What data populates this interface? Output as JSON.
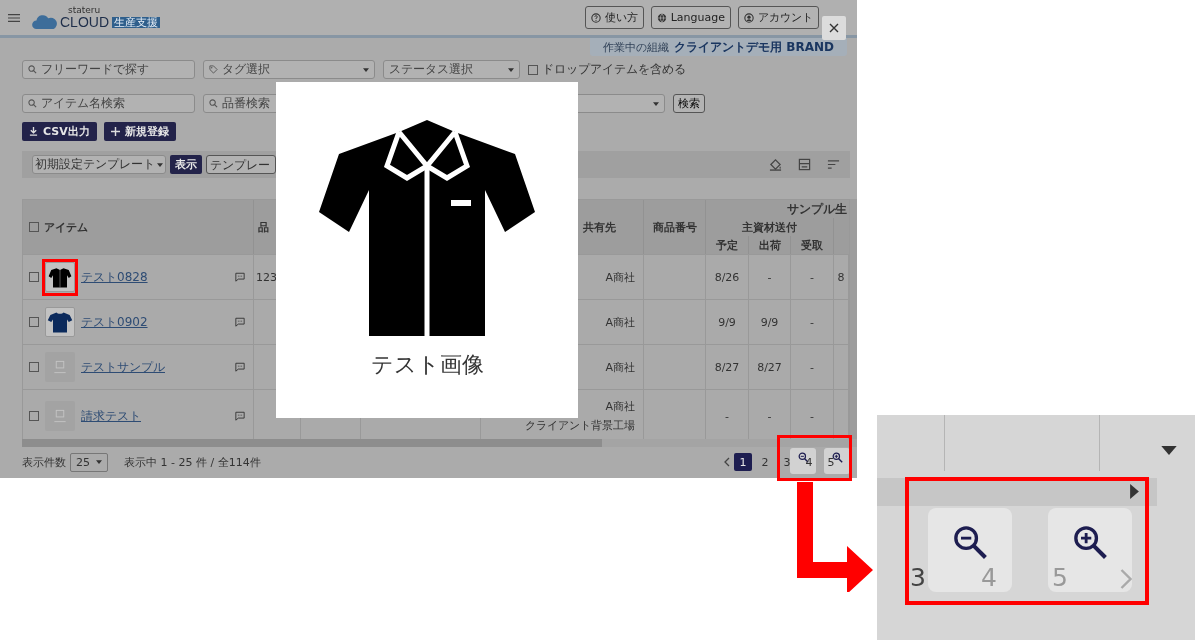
{
  "header": {
    "logo_small": "stateru",
    "logo": "CLOUD",
    "logo_badge": "生産支援",
    "buttons": [
      {
        "label": "使い方"
      },
      {
        "label": "Language"
      },
      {
        "label": "アカウント"
      }
    ]
  },
  "org_banner": {
    "label": "作業中の組織",
    "value": "クライアントデモ用 BRAND"
  },
  "filters": {
    "row1": [
      {
        "kind": "search",
        "placeholder": "フリーワードで探す"
      },
      {
        "kind": "tag",
        "placeholder": "タグ選択"
      },
      {
        "kind": "select",
        "placeholder": "ステータス選択"
      }
    ],
    "drop_checkbox": {
      "label": "ドロップアイテムを含める",
      "checked": false
    },
    "row2": [
      {
        "kind": "search",
        "placeholder": "アイテム名検索"
      },
      {
        "kind": "search",
        "placeholder": "品番検索"
      },
      {
        "kind": "select"
      }
    ],
    "search_button": "検索"
  },
  "actions": [
    {
      "label": "CSV出力"
    },
    {
      "label": "新規登録"
    }
  ],
  "template_bar": {
    "template": "初期設定テンプレート",
    "show_button": "表示",
    "template_field": "テンプレー"
  },
  "table": {
    "select_all_checked": false,
    "columns": {
      "item": "アイテム",
      "hinban": "品",
      "shared": "共有先",
      "product_no": "商品番号",
      "group": "サンプル生",
      "subgroup": "主資材送付",
      "sub": [
        "予定",
        "出荷",
        "受取"
      ]
    },
    "rows": [
      {
        "checked": false,
        "kind": "shirt",
        "highlighted": true,
        "name": "テスト0828",
        "hinban": "123",
        "shared": [
          "A商社"
        ],
        "cells": [
          "8/26",
          "-",
          "-",
          "8"
        ]
      },
      {
        "checked": false,
        "kind": "tshirt",
        "highlighted": false,
        "name": "テスト0902",
        "shared": [
          "A商社"
        ],
        "cells": [
          "9/9",
          "9/9",
          "-",
          ""
        ]
      },
      {
        "checked": false,
        "kind": "empty",
        "highlighted": false,
        "name": "テストサンプル",
        "shared": [
          "A商社"
        ],
        "cells": [
          "8/27",
          "8/27",
          "-",
          ""
        ]
      },
      {
        "checked": false,
        "kind": "empty",
        "highlighted": false,
        "name": "請求テスト",
        "shared": [
          "A商社",
          "クライアント背景工場"
        ],
        "cells": [
          "-",
          "-",
          "-",
          ""
        ]
      }
    ]
  },
  "footer": {
    "per_page_label": "表示件数",
    "per_page": "25",
    "summary": "表示中 1 - 25 件 / 全114件",
    "pages": [
      {
        "label": "1",
        "selected": true
      },
      {
        "label": "2",
        "selected": false
      },
      {
        "label": "3",
        "selected": false
      },
      {
        "label": "4",
        "selected": false
      },
      {
        "label": "5",
        "selected": false
      }
    ]
  },
  "modal": {
    "caption": "テスト画像"
  },
  "inset": {
    "pages": [
      "3",
      "4",
      "5"
    ]
  }
}
